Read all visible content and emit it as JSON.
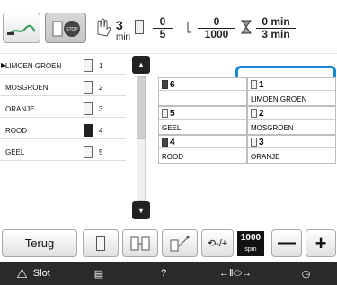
{
  "header": {
    "time_unit": "min",
    "thread_change_minutes": "3",
    "color_step": {
      "current": "0",
      "total": "5"
    },
    "stitch_count": {
      "current": "0",
      "total": "1000"
    },
    "time_to_end": {
      "current": "0 min",
      "total": "3 min"
    }
  },
  "thread_list": [
    {
      "name": "LIMOEN GROEN",
      "number": "1",
      "selected": true
    },
    {
      "name": "MOSGROEN",
      "number": "2"
    },
    {
      "name": "ORANJE",
      "number": "3"
    },
    {
      "name": "ROOD",
      "number": "4"
    },
    {
      "name": "GEEL",
      "number": "5"
    }
  ],
  "thread_grid": [
    {
      "slot": "6",
      "name": ""
    },
    {
      "slot": "1",
      "name": "LIMOEN GROEN"
    },
    {
      "slot": "5",
      "name": "GEEL"
    },
    {
      "slot": "2",
      "name": "MOSGROEN"
    },
    {
      "slot": "4",
      "name": "ROOD"
    },
    {
      "slot": "3",
      "name": "ORANJE"
    }
  ],
  "bottom": {
    "back_label": "Terug",
    "speed_value": "1000",
    "speed_unit": "spm",
    "minus": "—",
    "plus": "+"
  },
  "footer": {
    "lock_label": "Slot"
  },
  "colors": {
    "accent_blue": "#168ad0",
    "footer_bg": "#2a2a2a"
  }
}
